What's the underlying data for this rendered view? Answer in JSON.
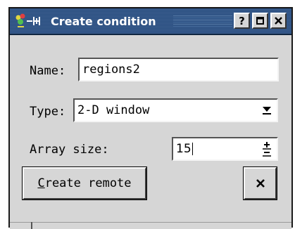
{
  "window": {
    "title": "Create condition",
    "title_buttons": {
      "help": "?",
      "maximize": "□",
      "close": "×"
    }
  },
  "form": {
    "name_label": "Name:",
    "name_value": "regions2",
    "type_label": "Type:",
    "type_value": "2-D window",
    "array_size_label": "Array size:",
    "array_size_value": "15"
  },
  "buttons": {
    "create_remote": "Create remote",
    "close": "×"
  },
  "colors": {
    "titlebar": "#2a4f82",
    "window_bg": "#d6d6d6",
    "field_bg": "#ffffff"
  }
}
